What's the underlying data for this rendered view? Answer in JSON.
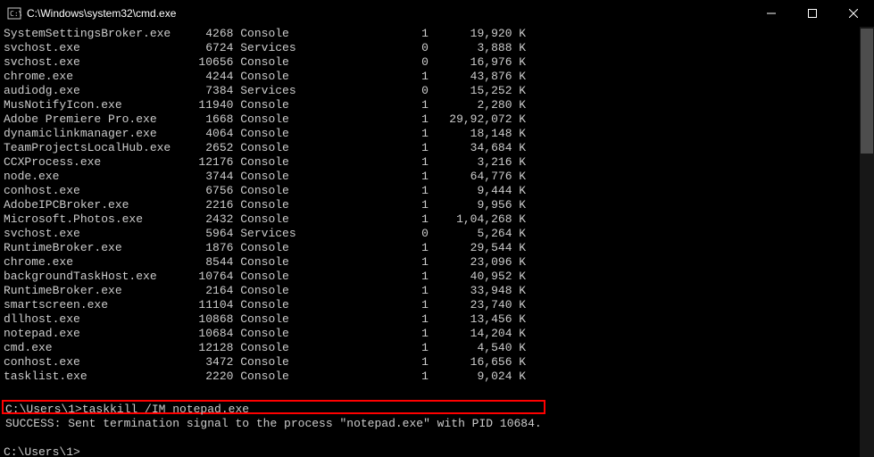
{
  "titlebar": {
    "title": "C:\\Windows\\system32\\cmd.exe"
  },
  "rows": [
    {
      "name": "SystemSettingsBroker.exe",
      "pid": "4268",
      "sess": "Console",
      "num": "1",
      "mem": "19,920",
      "unit": "K"
    },
    {
      "name": "svchost.exe",
      "pid": "6724",
      "sess": "Services",
      "num": "0",
      "mem": "3,888",
      "unit": "K"
    },
    {
      "name": "svchost.exe",
      "pid": "10656",
      "sess": "Console",
      "num": "0",
      "mem": "16,976",
      "unit": "K"
    },
    {
      "name": "chrome.exe",
      "pid": "4244",
      "sess": "Console",
      "num": "1",
      "mem": "43,876",
      "unit": "K"
    },
    {
      "name": "audiodg.exe",
      "pid": "7384",
      "sess": "Services",
      "num": "0",
      "mem": "15,252",
      "unit": "K"
    },
    {
      "name": "MusNotifyIcon.exe",
      "pid": "11940",
      "sess": "Console",
      "num": "1",
      "mem": "2,280",
      "unit": "K"
    },
    {
      "name": "Adobe Premiere Pro.exe",
      "pid": "1668",
      "sess": "Console",
      "num": "1",
      "mem": "29,92,072",
      "unit": "K"
    },
    {
      "name": "dynamiclinkmanager.exe",
      "pid": "4064",
      "sess": "Console",
      "num": "1",
      "mem": "18,148",
      "unit": "K"
    },
    {
      "name": "TeamProjectsLocalHub.exe",
      "pid": "2652",
      "sess": "Console",
      "num": "1",
      "mem": "34,684",
      "unit": "K"
    },
    {
      "name": "CCXProcess.exe",
      "pid": "12176",
      "sess": "Console",
      "num": "1",
      "mem": "3,216",
      "unit": "K"
    },
    {
      "name": "node.exe",
      "pid": "3744",
      "sess": "Console",
      "num": "1",
      "mem": "64,776",
      "unit": "K"
    },
    {
      "name": "conhost.exe",
      "pid": "6756",
      "sess": "Console",
      "num": "1",
      "mem": "9,444",
      "unit": "K"
    },
    {
      "name": "AdobeIPCBroker.exe",
      "pid": "2216",
      "sess": "Console",
      "num": "1",
      "mem": "9,956",
      "unit": "K"
    },
    {
      "name": "Microsoft.Photos.exe",
      "pid": "2432",
      "sess": "Console",
      "num": "1",
      "mem": "1,04,268",
      "unit": "K"
    },
    {
      "name": "svchost.exe",
      "pid": "5964",
      "sess": "Services",
      "num": "0",
      "mem": "5,264",
      "unit": "K"
    },
    {
      "name": "RuntimeBroker.exe",
      "pid": "1876",
      "sess": "Console",
      "num": "1",
      "mem": "29,544",
      "unit": "K"
    },
    {
      "name": "chrome.exe",
      "pid": "8544",
      "sess": "Console",
      "num": "1",
      "mem": "23,096",
      "unit": "K"
    },
    {
      "name": "backgroundTaskHost.exe",
      "pid": "10764",
      "sess": "Console",
      "num": "1",
      "mem": "40,952",
      "unit": "K"
    },
    {
      "name": "RuntimeBroker.exe",
      "pid": "2164",
      "sess": "Console",
      "num": "1",
      "mem": "33,948",
      "unit": "K"
    },
    {
      "name": "smartscreen.exe",
      "pid": "11104",
      "sess": "Console",
      "num": "1",
      "mem": "23,740",
      "unit": "K"
    },
    {
      "name": "dllhost.exe",
      "pid": "10868",
      "sess": "Console",
      "num": "1",
      "mem": "13,456",
      "unit": "K"
    },
    {
      "name": "notepad.exe",
      "pid": "10684",
      "sess": "Console",
      "num": "1",
      "mem": "14,204",
      "unit": "K"
    },
    {
      "name": "cmd.exe",
      "pid": "12128",
      "sess": "Console",
      "num": "1",
      "mem": "4,540",
      "unit": "K"
    },
    {
      "name": "conhost.exe",
      "pid": "3472",
      "sess": "Console",
      "num": "1",
      "mem": "16,656",
      "unit": "K"
    },
    {
      "name": "tasklist.exe",
      "pid": "2220",
      "sess": "Console",
      "num": "1",
      "mem": "9,024",
      "unit": "K"
    }
  ],
  "command": {
    "prompt": "C:\\Users\\1>",
    "text": "taskkill /IM notepad.exe",
    "result": "SUCCESS: Sent termination signal to the process \"notepad.exe\" with PID 10684."
  },
  "prompt2": "C:\\Users\\1>"
}
